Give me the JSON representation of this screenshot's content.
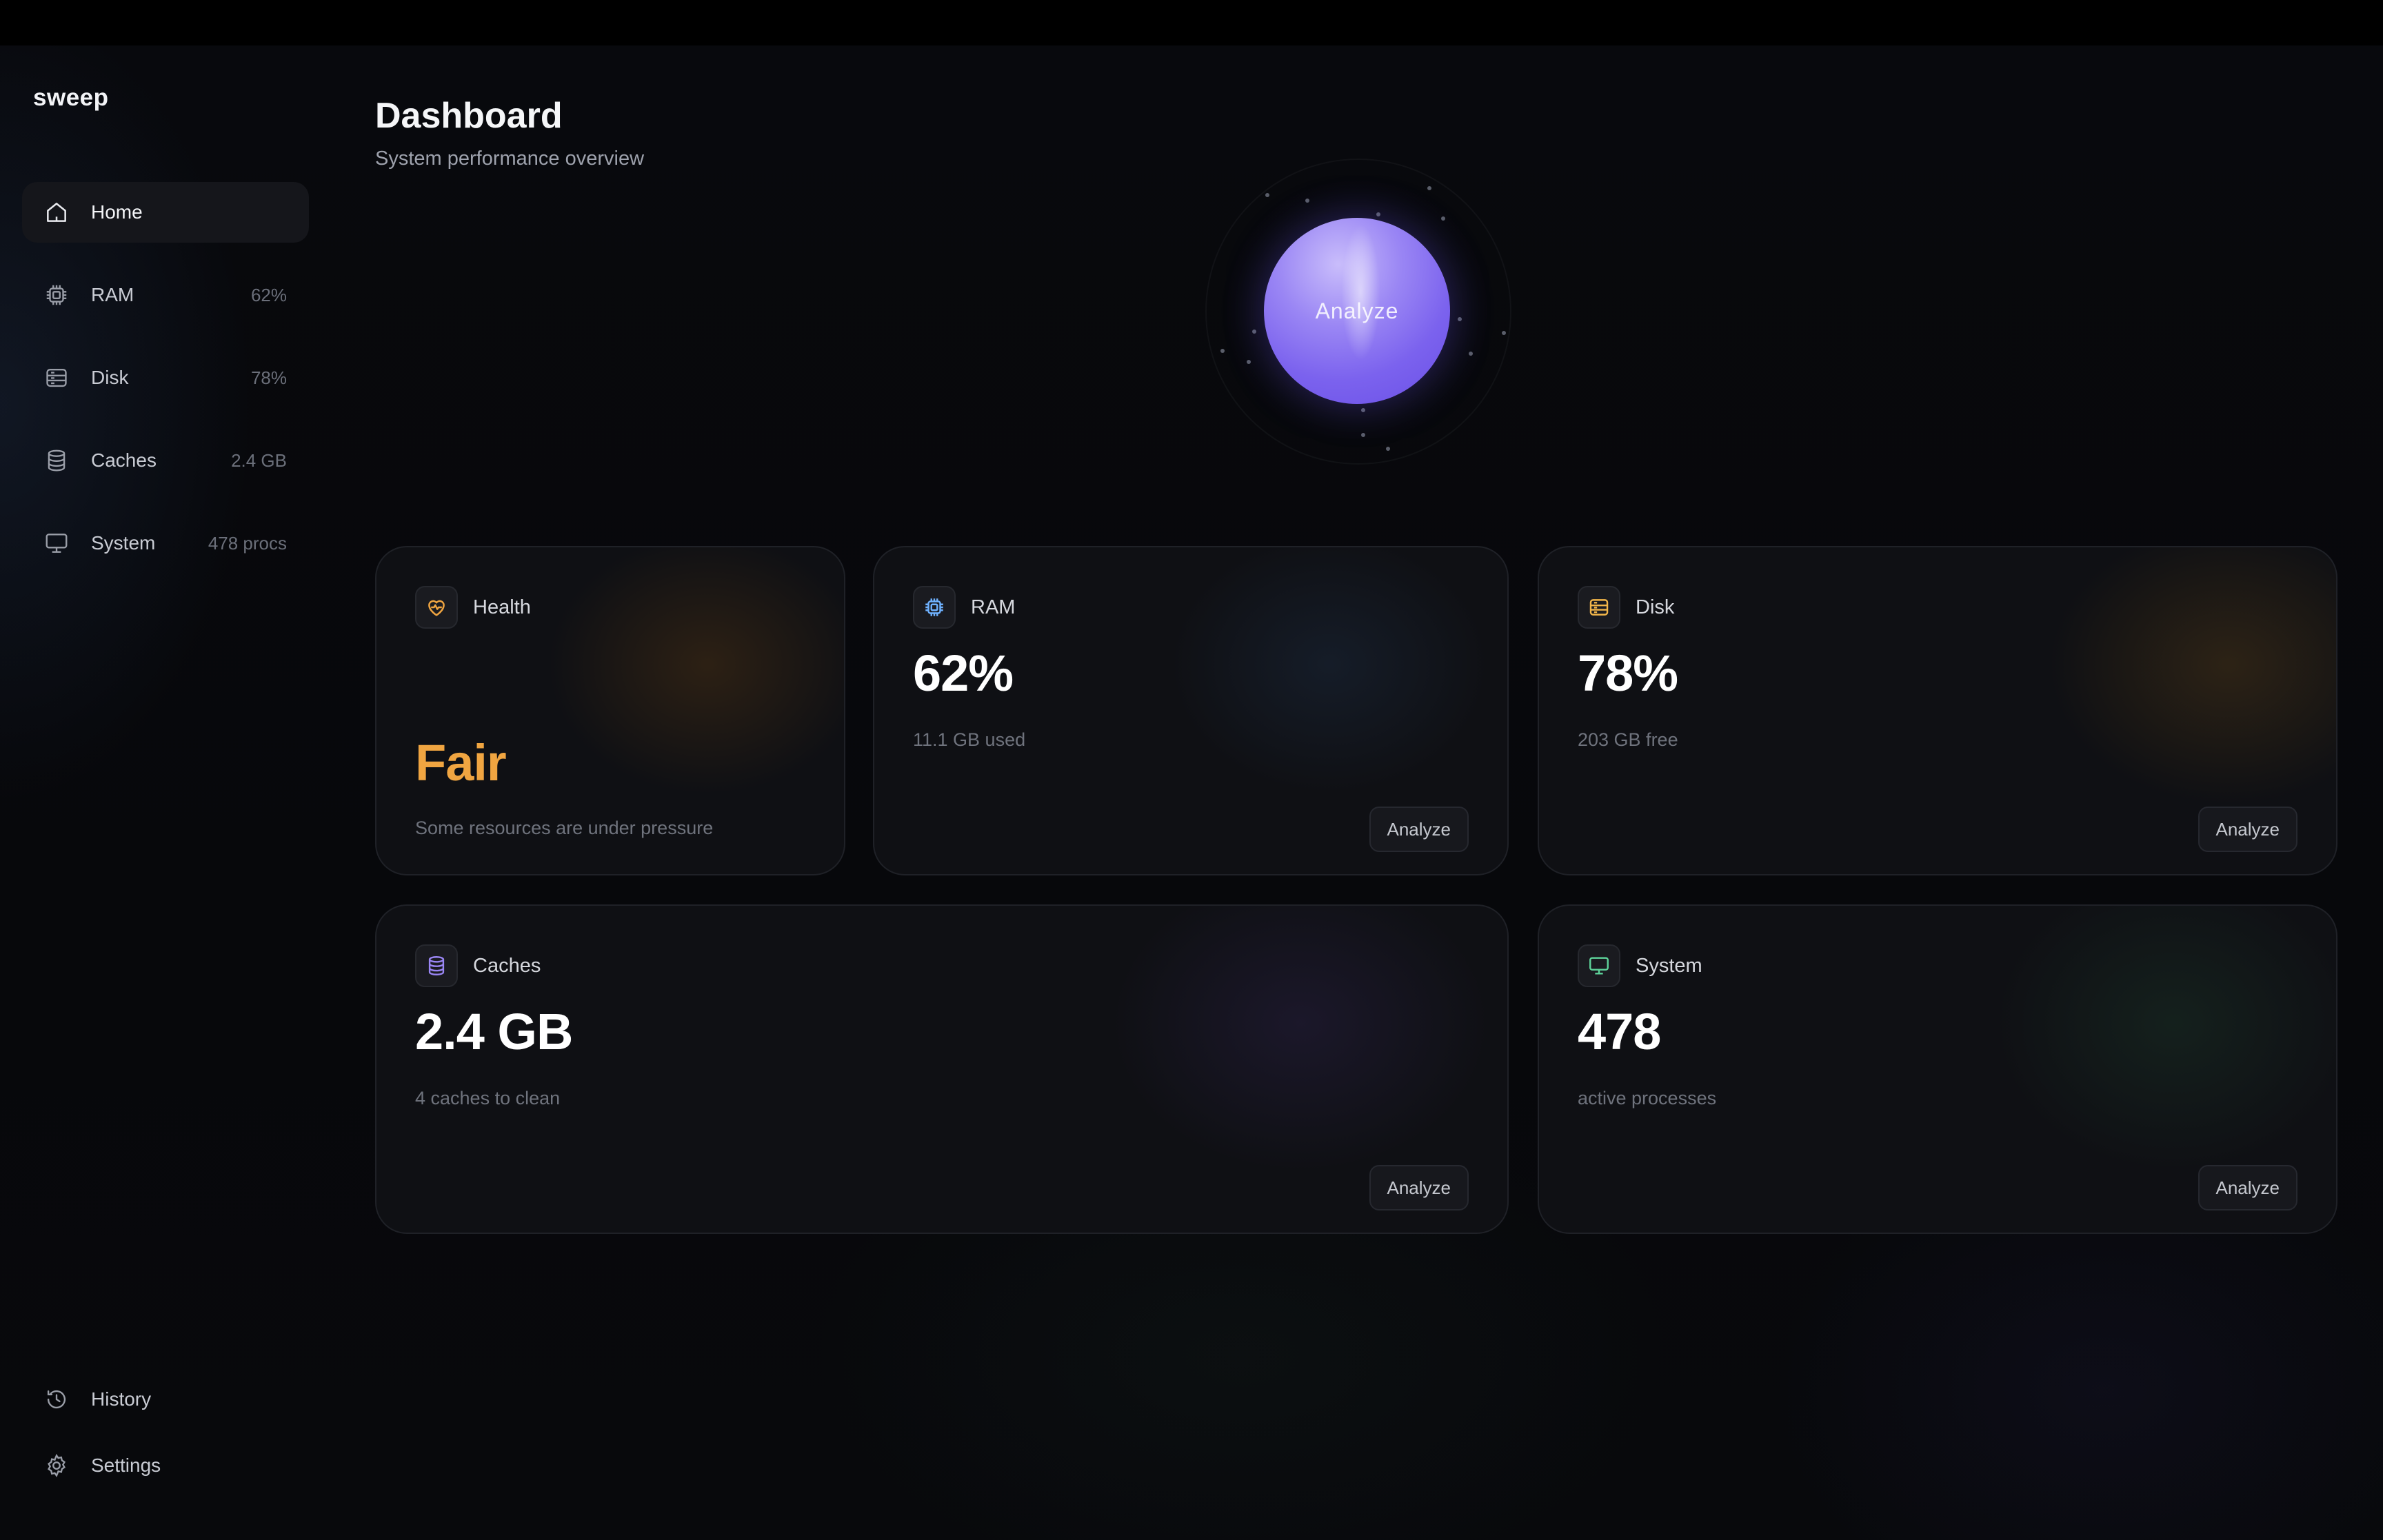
{
  "app": {
    "name": "sweep"
  },
  "sidebar": {
    "items": [
      {
        "label": "Home",
        "meta": ""
      },
      {
        "label": "RAM",
        "meta": "62%"
      },
      {
        "label": "Disk",
        "meta": "78%"
      },
      {
        "label": "Caches",
        "meta": "2.4 GB"
      },
      {
        "label": "System",
        "meta": "478 procs"
      }
    ],
    "footer": [
      {
        "label": "History"
      },
      {
        "label": "Settings"
      }
    ]
  },
  "header": {
    "title": "Dashboard",
    "subtitle": "System performance overview"
  },
  "orb": {
    "label": "Analyze"
  },
  "cards": {
    "health": {
      "title": "Health",
      "value": "Fair",
      "subtitle": "Some resources are under pressure",
      "value_color": "#f0a541"
    },
    "ram": {
      "title": "RAM",
      "value": "62%",
      "subtitle": "11.1 GB used",
      "button": "Analyze"
    },
    "disk": {
      "title": "Disk",
      "value": "78%",
      "subtitle": "203 GB free",
      "button": "Analyze"
    },
    "caches": {
      "title": "Caches",
      "value": "2.4 GB",
      "subtitle": "4 caches to clean",
      "button": "Analyze"
    },
    "system": {
      "title": "System",
      "value": "478",
      "subtitle": "active processes",
      "button": "Analyze"
    }
  },
  "colors": {
    "health_accent": "#f0a541",
    "ram_accent": "#6fb2ff",
    "disk_accent": "#f2b64a",
    "caches_accent": "#9a86f4",
    "system_accent": "#5ed39a",
    "orb": "#7b62ee"
  }
}
